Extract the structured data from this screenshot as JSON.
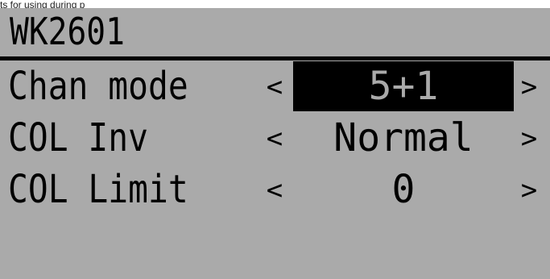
{
  "caption": "ts for using during p",
  "screen": {
    "title": "WK2601",
    "rows": [
      {
        "label": "Chan mode",
        "value": "5+1",
        "left_arrow": "<",
        "right_arrow": ">",
        "selected": true
      },
      {
        "label": "COL Inv",
        "value": "Normal",
        "left_arrow": "<",
        "right_arrow": ">",
        "selected": false
      },
      {
        "label": "COL Limit",
        "value": "0",
        "left_arrow": "<",
        "right_arrow": ">",
        "selected": false
      }
    ]
  },
  "colors": {
    "lcd_background": "#aaaaaa",
    "lcd_text": "#000000",
    "selection_background": "#000000",
    "selection_text": "#aaaaaa"
  }
}
